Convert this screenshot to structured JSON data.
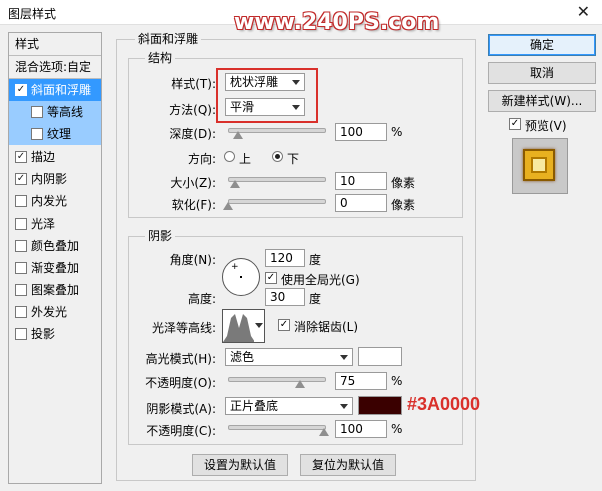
{
  "window": {
    "title": "图层样式",
    "watermark": "www.240PS.com"
  },
  "left_panel": {
    "header": "样式",
    "blend": "混合选项:自定",
    "items": [
      {
        "label": "斜面和浮雕",
        "checked": true
      },
      {
        "label": "等高线",
        "checked": false
      },
      {
        "label": "纹理",
        "checked": false
      },
      {
        "label": "描边",
        "checked": true
      },
      {
        "label": "内阴影",
        "checked": true
      },
      {
        "label": "内发光",
        "checked": false
      },
      {
        "label": "光泽",
        "checked": false
      },
      {
        "label": "颜色叠加",
        "checked": false
      },
      {
        "label": "渐变叠加",
        "checked": false
      },
      {
        "label": "图案叠加",
        "checked": false
      },
      {
        "label": "外发光",
        "checked": false
      },
      {
        "label": "投影",
        "checked": false
      }
    ]
  },
  "bevel": {
    "title": "斜面和浮雕",
    "structure_title": "结构",
    "style_label": "样式(T):",
    "style_value": "枕状浮雕",
    "technique_label": "方法(Q):",
    "technique_value": "平滑",
    "depth_label": "深度(D):",
    "depth_value": "100",
    "depth_unit": "%",
    "depth_level": 0.1,
    "direction_label": "方向:",
    "direction_up": "上",
    "direction_down": "下",
    "direction_selected": "下",
    "size_label": "大小(Z):",
    "size_value": "10",
    "size_unit": "像素",
    "size_level": 0.07,
    "soften_label": "软化(F):",
    "soften_value": "0",
    "soften_unit": "像素",
    "soften_level": 0.0
  },
  "shading": {
    "title": "阴影",
    "angle_label": "角度(N):",
    "angle_value": "120",
    "angle_unit": "度",
    "global_light_label": "使用全局光(G)",
    "global_light_checked": true,
    "altitude_label": "高度:",
    "altitude_value": "30",
    "altitude_unit": "度",
    "gloss_label": "光泽等高线:",
    "antialias_label": "消除锯齿(L)",
    "antialias_checked": true,
    "highlight_mode_label": "高光模式(H):",
    "highlight_mode_value": "滤色",
    "highlight_color": "#ffffff",
    "highlight_opacity_label": "不透明度(O):",
    "highlight_opacity_value": "75",
    "highlight_opacity_unit": "%",
    "highlight_opacity_level": 0.75,
    "shadow_mode_label": "阴影模式(A):",
    "shadow_mode_value": "正片叠底",
    "shadow_color": "#3A0000",
    "shadow_color_annotation": "#3A0000",
    "shadow_opacity_label": "不透明度(C):",
    "shadow_opacity_value": "100",
    "shadow_opacity_unit": "%",
    "shadow_opacity_level": 1.0
  },
  "buttons": {
    "make_default": "设置为默认值",
    "reset_default": "复位为默认值",
    "ok": "确定",
    "cancel": "取消",
    "new_style": "新建样式(W)...",
    "preview": "预览(V)",
    "preview_checked": true
  },
  "colors": {
    "accent": "#3399ff",
    "selection_sub": "#99ccff",
    "annotation_red": "#d9302b",
    "preview_gold": "#e8b020"
  }
}
